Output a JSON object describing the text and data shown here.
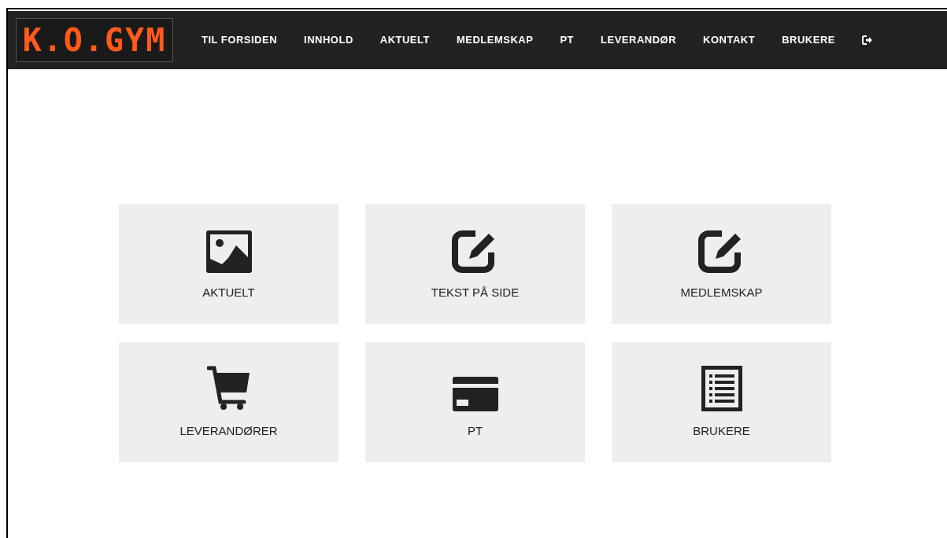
{
  "logo": {
    "text": "K.O.GYM"
  },
  "nav": [
    {
      "label": "TIL FORSIDEN"
    },
    {
      "label": "INNHOLD"
    },
    {
      "label": "AKTUELT"
    },
    {
      "label": "MEDLEMSKAP"
    },
    {
      "label": "PT"
    },
    {
      "label": "LEVERANDØR"
    },
    {
      "label": "KONTAKT"
    },
    {
      "label": "BRUKERE"
    }
  ],
  "tiles": [
    {
      "label": "AKTUELT",
      "kind": "image"
    },
    {
      "label": "TEKST PÅ SIDE",
      "kind": "edit"
    },
    {
      "label": "MEDLEMSKAP",
      "kind": "edit"
    },
    {
      "label": "LEVERANDØRER",
      "kind": "cart"
    },
    {
      "label": "PT",
      "kind": "card"
    },
    {
      "label": "BRUKERE",
      "kind": "list"
    }
  ]
}
